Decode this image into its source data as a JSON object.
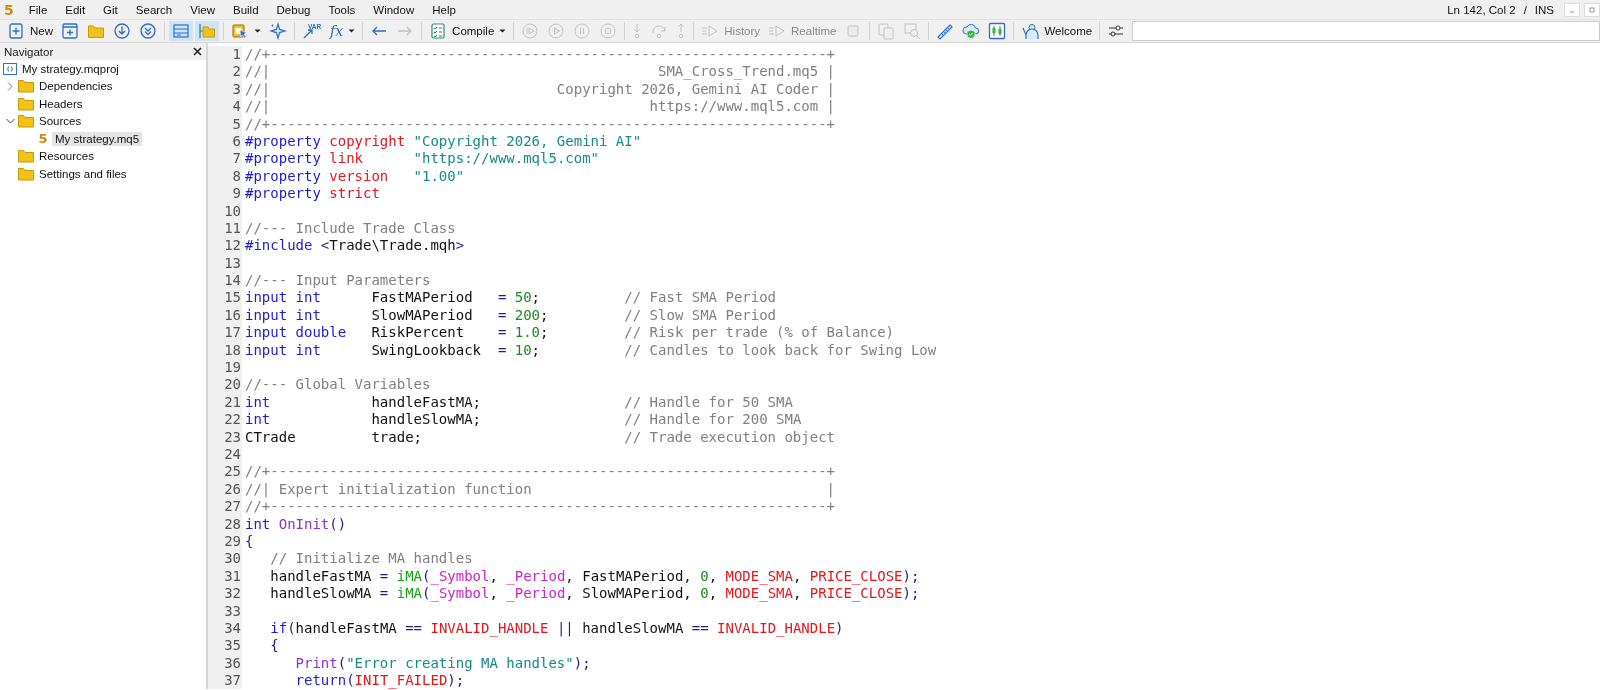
{
  "app_logo": "5",
  "menu": [
    "File",
    "Edit",
    "Git",
    "Search",
    "View",
    "Build",
    "Debug",
    "Tools",
    "Window",
    "Help"
  ],
  "status": {
    "position": "Ln 142, Col 2",
    "separator": "/",
    "mode": "INS"
  },
  "toolbar": {
    "groups": [
      [
        {
          "kind": "new-file",
          "label": "New",
          "selected": false,
          "disabled": false
        },
        {
          "kind": "new-window",
          "selected": false,
          "disabled": false
        },
        {
          "kind": "folder",
          "selected": false,
          "disabled": false
        },
        {
          "kind": "download",
          "selected": false,
          "disabled": false
        },
        {
          "kind": "download-double",
          "selected": false,
          "disabled": false
        }
      ],
      [
        {
          "kind": "layout",
          "selected": true,
          "disabled": false
        },
        {
          "kind": "folder-tree",
          "selected": true,
          "disabled": false
        }
      ],
      [
        {
          "kind": "clipboard",
          "dropdown": true,
          "selected": false,
          "disabled": false
        },
        {
          "kind": "sparkle",
          "selected": false,
          "disabled": false
        }
      ],
      [
        {
          "kind": "var-arrow",
          "glyph": "VAR",
          "selected": false,
          "disabled": false
        },
        {
          "kind": "function",
          "glyph": "fx",
          "dropdown": true,
          "selected": false,
          "disabled": false
        }
      ],
      [
        {
          "kind": "back",
          "selected": false,
          "disabled": false
        },
        {
          "kind": "forward",
          "selected": false,
          "disabled": true
        }
      ],
      [
        {
          "kind": "checklist",
          "label": "Compile",
          "dropdown": true,
          "selected": false,
          "disabled": false
        }
      ],
      [
        {
          "kind": "play-bar",
          "selected": false,
          "disabled": true
        },
        {
          "kind": "play",
          "selected": false,
          "disabled": true
        },
        {
          "kind": "pause",
          "selected": false,
          "disabled": true
        },
        {
          "kind": "stop-circle",
          "selected": false,
          "disabled": true
        }
      ],
      [
        {
          "kind": "step-into",
          "selected": false,
          "disabled": true
        },
        {
          "kind": "step-over",
          "selected": false,
          "disabled": true
        },
        {
          "kind": "step-out",
          "selected": false,
          "disabled": true
        }
      ],
      [
        {
          "kind": "history",
          "label": "History",
          "selected": false,
          "disabled": true
        },
        {
          "kind": "realtime",
          "label": "Realtime",
          "selected": false,
          "disabled": true
        },
        {
          "kind": "stop-square",
          "selected": false,
          "disabled": true
        }
      ],
      [
        {
          "kind": "copy",
          "selected": false,
          "disabled": true
        },
        {
          "kind": "find",
          "selected": false,
          "disabled": true
        }
      ],
      [
        {
          "kind": "comb",
          "selected": false,
          "disabled": false
        },
        {
          "kind": "cloud-shield",
          "selected": false,
          "disabled": false
        },
        {
          "kind": "chart",
          "selected": false,
          "disabled": false
        }
      ],
      [
        {
          "kind": "person",
          "label": "Welcome",
          "selected": false,
          "disabled": false
        }
      ],
      [
        {
          "kind": "sliders",
          "selected": false,
          "disabled": false
        }
      ]
    ]
  },
  "navigator": {
    "title": "Navigator",
    "tree": [
      {
        "kind": "project",
        "label": "My strategy.mqproj",
        "selected": false,
        "children": [
          {
            "kind": "folder",
            "label": "Dependencies",
            "expanded": false,
            "selected": false
          },
          {
            "kind": "folder",
            "label": "Headers",
            "selected": false
          },
          {
            "kind": "folder",
            "label": "Sources",
            "expanded": true,
            "selected": false,
            "children": [
              {
                "kind": "source",
                "icon_glyph": "5",
                "label": "My strategy.mq5",
                "selected": true
              }
            ]
          },
          {
            "kind": "folder",
            "label": "Resources",
            "selected": false
          },
          {
            "kind": "folder",
            "label": "Settings and files",
            "selected": false
          }
        ]
      }
    ]
  },
  "editor": {
    "lines": [
      {
        "number": "1",
        "tokens": [
          {
            "kind": "comment",
            "text": "//+------------------------------------------------------------------+"
          }
        ]
      },
      {
        "number": "2",
        "tokens": [
          {
            "kind": "comment",
            "text": "//|                                              SMA_Cross_Trend.mq5 |"
          }
        ]
      },
      {
        "number": "3",
        "tokens": [
          {
            "kind": "comment",
            "text": "//|                                  Copyright 2026, Gemini AI Coder |"
          }
        ]
      },
      {
        "number": "4",
        "tokens": [
          {
            "kind": "comment",
            "text": "//|                                             https://www.mql5.com |"
          }
        ]
      },
      {
        "number": "5",
        "tokens": [
          {
            "kind": "comment",
            "text": "//+------------------------------------------------------------------+"
          }
        ]
      },
      {
        "number": "6",
        "tokens": [
          {
            "kind": "keyword",
            "text": "#property"
          },
          {
            "kind": "constant",
            "text": " copyright"
          },
          {
            "kind": "string",
            "text": " \"Copyright 2026, Gemini AI\""
          }
        ]
      },
      {
        "number": "7",
        "tokens": [
          {
            "kind": "keyword",
            "text": "#property"
          },
          {
            "kind": "constant",
            "text": " link"
          },
          {
            "kind": "string",
            "text": "      \"https://www.mql5.com\""
          }
        ]
      },
      {
        "number": "8",
        "tokens": [
          {
            "kind": "keyword",
            "text": "#property"
          },
          {
            "kind": "constant",
            "text": " version"
          },
          {
            "kind": "string",
            "text": "   \"1.00\""
          }
        ]
      },
      {
        "number": "9",
        "tokens": [
          {
            "kind": "keyword",
            "text": "#property"
          },
          {
            "kind": "constant",
            "text": " strict"
          }
        ]
      },
      {
        "number": "10"
      },
      {
        "number": "11",
        "tokens": [
          {
            "kind": "comment",
            "text": "//--- Include Trade Class"
          }
        ]
      },
      {
        "number": "12",
        "tokens": [
          {
            "kind": "keyword",
            "text": "#include"
          },
          {
            "kind": "operator",
            "text": " <"
          },
          {
            "kind": "plain",
            "text": "Trade\\Trade.mqh"
          },
          {
            "kind": "operator",
            "text": ">"
          }
        ]
      },
      {
        "number": "13"
      },
      {
        "number": "14",
        "tokens": [
          {
            "kind": "comment",
            "text": "//--- Input Parameters"
          }
        ]
      },
      {
        "number": "15",
        "tokens": [
          {
            "kind": "keyword",
            "text": "input int"
          },
          {
            "kind": "plain",
            "text": "      FastMAPeriod   "
          },
          {
            "kind": "operator",
            "text": "="
          },
          {
            "kind": "number",
            "text": " 50"
          },
          {
            "kind": "plain",
            "text": ";          "
          },
          {
            "kind": "comment",
            "text": "// Fast SMA Period"
          }
        ]
      },
      {
        "number": "16",
        "tokens": [
          {
            "kind": "keyword",
            "text": "input int"
          },
          {
            "kind": "plain",
            "text": "      SlowMAPeriod   "
          },
          {
            "kind": "operator",
            "text": "="
          },
          {
            "kind": "number",
            "text": " 200"
          },
          {
            "kind": "plain",
            "text": ";         "
          },
          {
            "kind": "comment",
            "text": "// Slow SMA Period"
          }
        ]
      },
      {
        "number": "17",
        "tokens": [
          {
            "kind": "keyword",
            "text": "input double"
          },
          {
            "kind": "plain",
            "text": "   RiskPercent    "
          },
          {
            "kind": "operator",
            "text": "="
          },
          {
            "kind": "number",
            "text": " 1.0"
          },
          {
            "kind": "plain",
            "text": ";         "
          },
          {
            "kind": "comment",
            "text": "// Risk per trade (% of Balance)"
          }
        ]
      },
      {
        "number": "18",
        "tokens": [
          {
            "kind": "keyword",
            "text": "input int"
          },
          {
            "kind": "plain",
            "text": "      SwingLookback  "
          },
          {
            "kind": "operator",
            "text": "="
          },
          {
            "kind": "number",
            "text": " 10"
          },
          {
            "kind": "plain",
            "text": ";          "
          },
          {
            "kind": "comment",
            "text": "// Candles to look back for Swing Low"
          }
        ]
      },
      {
        "number": "19"
      },
      {
        "number": "20",
        "tokens": [
          {
            "kind": "comment",
            "text": "//--- Global Variables"
          }
        ]
      },
      {
        "number": "21",
        "tokens": [
          {
            "kind": "keyword",
            "text": "int"
          },
          {
            "kind": "plain",
            "text": "            handleFastMA;                 "
          },
          {
            "kind": "comment",
            "text": "// Handle for 50 SMA"
          }
        ]
      },
      {
        "number": "22",
        "tokens": [
          {
            "kind": "keyword",
            "text": "int"
          },
          {
            "kind": "plain",
            "text": "            handleSlowMA;                 "
          },
          {
            "kind": "comment",
            "text": "// Handle for 200 SMA"
          }
        ]
      },
      {
        "number": "23",
        "tokens": [
          {
            "kind": "plain",
            "text": "CTrade         trade;                        "
          },
          {
            "kind": "comment",
            "text": "// Trade execution object"
          }
        ]
      },
      {
        "number": "24"
      },
      {
        "number": "25",
        "tokens": [
          {
            "kind": "comment",
            "text": "//+------------------------------------------------------------------+"
          }
        ]
      },
      {
        "number": "26",
        "tokens": [
          {
            "kind": "comment",
            "text": "//| Expert initialization function                                   |"
          }
        ]
      },
      {
        "number": "27",
        "tokens": [
          {
            "kind": "comment",
            "text": "//+------------------------------------------------------------------+"
          }
        ]
      },
      {
        "number": "28",
        "tokens": [
          {
            "kind": "keyword",
            "text": "int"
          },
          {
            "kind": "function",
            "text": " OnInit"
          },
          {
            "kind": "operator",
            "text": "()"
          }
        ]
      },
      {
        "number": "29",
        "tokens": [
          {
            "kind": "operator",
            "text": "{"
          }
        ]
      },
      {
        "number": "30",
        "tokens": [
          {
            "kind": "comment",
            "text": "   // Initialize MA handles"
          }
        ]
      },
      {
        "number": "31",
        "tokens": [
          {
            "kind": "plain",
            "text": "   handleFastMA "
          },
          {
            "kind": "operator",
            "text": "="
          },
          {
            "kind": "builtin",
            "text": " iMA"
          },
          {
            "kind": "operator",
            "text": "("
          },
          {
            "kind": "predefined",
            "text": "_Symbol"
          },
          {
            "kind": "plain",
            "text": ", "
          },
          {
            "kind": "predefined",
            "text": "_Period"
          },
          {
            "kind": "plain",
            "text": ", FastMAPeriod, "
          },
          {
            "kind": "number",
            "text": "0"
          },
          {
            "kind": "plain",
            "text": ", "
          },
          {
            "kind": "constant",
            "text": "MODE_SMA"
          },
          {
            "kind": "plain",
            "text": ", "
          },
          {
            "kind": "constant",
            "text": "PRICE_CLOSE"
          },
          {
            "kind": "operator",
            "text": ");"
          }
        ]
      },
      {
        "number": "32",
        "tokens": [
          {
            "kind": "plain",
            "text": "   handleSlowMA "
          },
          {
            "kind": "operator",
            "text": "="
          },
          {
            "kind": "builtin",
            "text": " iMA"
          },
          {
            "kind": "operator",
            "text": "("
          },
          {
            "kind": "predefined",
            "text": "_Symbol"
          },
          {
            "kind": "plain",
            "text": ", "
          },
          {
            "kind": "predefined",
            "text": "_Period"
          },
          {
            "kind": "plain",
            "text": ", SlowMAPeriod, "
          },
          {
            "kind": "number",
            "text": "0"
          },
          {
            "kind": "plain",
            "text": ", "
          },
          {
            "kind": "constant",
            "text": "MODE_SMA"
          },
          {
            "kind": "plain",
            "text": ", "
          },
          {
            "kind": "constant",
            "text": "PRICE_CLOSE"
          },
          {
            "kind": "operator",
            "text": ");"
          }
        ]
      },
      {
        "number": "33"
      },
      {
        "number": "34",
        "tokens": [
          {
            "kind": "keyword",
            "text": "   if"
          },
          {
            "kind": "operator",
            "text": "("
          },
          {
            "kind": "plain",
            "text": "handleFastMA "
          },
          {
            "kind": "operator",
            "text": "=="
          },
          {
            "kind": "constant",
            "text": " INVALID_HANDLE"
          },
          {
            "kind": "operator",
            "text": " ||"
          },
          {
            "kind": "plain",
            "text": " handleSlowMA "
          },
          {
            "kind": "operator",
            "text": "=="
          },
          {
            "kind": "constant",
            "text": " INVALID_HANDLE"
          },
          {
            "kind": "operator",
            "text": ")"
          }
        ]
      },
      {
        "number": "35",
        "tokens": [
          {
            "kind": "operator",
            "text": "   {"
          }
        ]
      },
      {
        "number": "36",
        "tokens": [
          {
            "kind": "function",
            "text": "      Print"
          },
          {
            "kind": "operator",
            "text": "("
          },
          {
            "kind": "string",
            "text": "\"Error creating MA handles\""
          },
          {
            "kind": "operator",
            "text": ");"
          }
        ]
      },
      {
        "number": "37",
        "tokens": [
          {
            "kind": "keyword",
            "text": "      return"
          },
          {
            "kind": "operator",
            "text": "("
          },
          {
            "kind": "constant",
            "text": "INIT_FAILED"
          },
          {
            "kind": "operator",
            "text": ");"
          }
        ]
      }
    ]
  }
}
